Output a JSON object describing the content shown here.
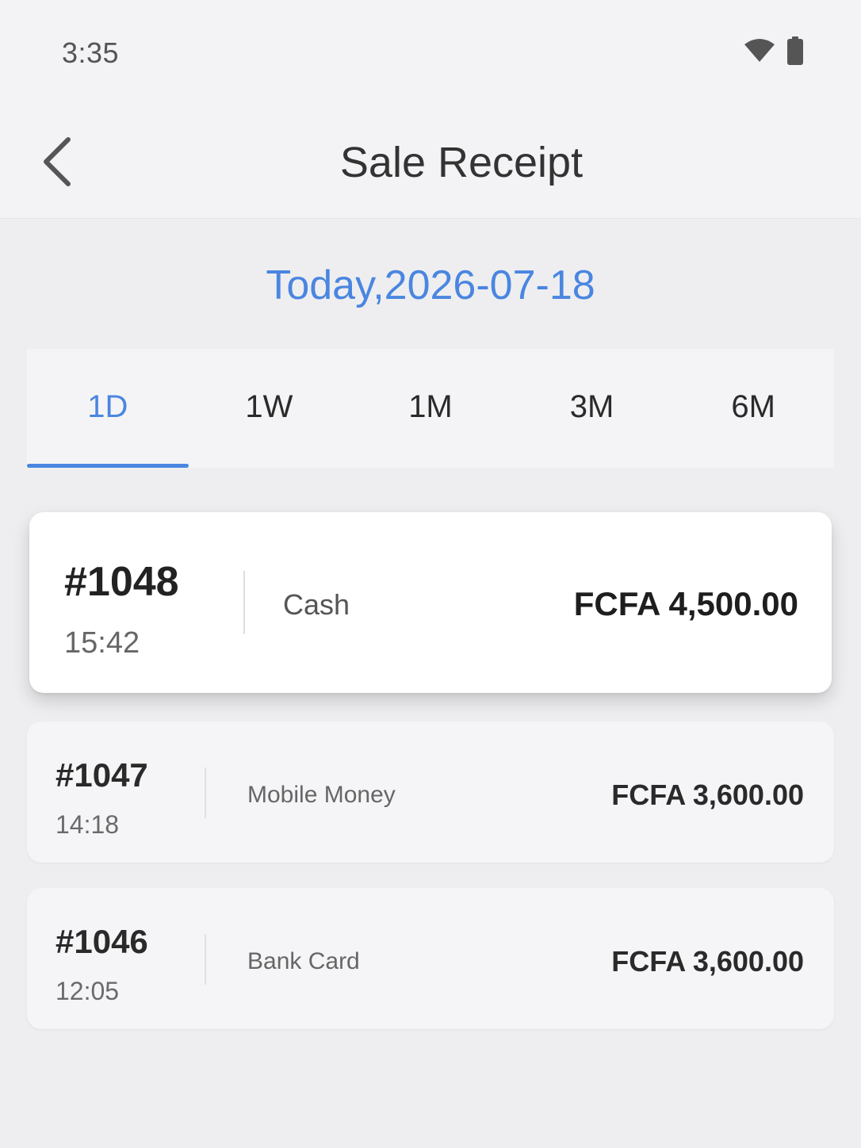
{
  "status_bar": {
    "time": "3:35",
    "icons": [
      "wifi-icon",
      "battery-icon"
    ]
  },
  "header": {
    "title": "Sale Receipt",
    "back_icon": "chevron-left-icon"
  },
  "date_label": "Today,2026-07-18",
  "tabs": [
    {
      "label": "1D",
      "active": true
    },
    {
      "label": "1W",
      "active": false
    },
    {
      "label": "1M",
      "active": false
    },
    {
      "label": "3M",
      "active": false
    },
    {
      "label": "6M",
      "active": false
    }
  ],
  "receipts": [
    {
      "id": "#1048",
      "time": "15:42",
      "method": "Cash",
      "amount": "FCFA 4,500.00"
    },
    {
      "id": "#1047",
      "time": "14:18",
      "method": "Mobile Money",
      "amount": "FCFA 3,600.00"
    },
    {
      "id": "#1046",
      "time": "12:05",
      "method": "Bank Card",
      "amount": "FCFA 3,600.00"
    }
  ],
  "colors": {
    "accent": "#4a86e0",
    "background": "#eeeef0"
  }
}
